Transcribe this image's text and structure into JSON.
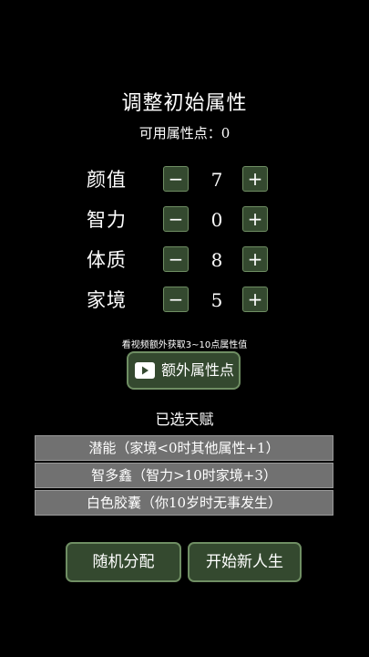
{
  "header": {
    "title": "调整初始属性",
    "points_text": "可用属性点：0"
  },
  "attributes": [
    {
      "label": "颜值",
      "value": "7",
      "minus": "−",
      "plus": "+"
    },
    {
      "label": "智力",
      "value": "0",
      "minus": "−",
      "plus": "+"
    },
    {
      "label": "体质",
      "value": "8",
      "minus": "−",
      "plus": "+"
    },
    {
      "label": "家境",
      "value": "5",
      "minus": "−",
      "plus": "+"
    }
  ],
  "extra": {
    "hint": "看视频额外获取3~10点属性值",
    "button_label": "额外属性点",
    "icon": "video-camera-icon"
  },
  "talents": {
    "title": "已选天赋",
    "items": [
      "潜能（家境<0时其他属性+1）",
      "智多鑫（智力>10时家境+3）",
      "白色胶囊（你10岁时无事发生）"
    ]
  },
  "actions": {
    "random_label": "随机分配",
    "start_label": "开始新人生"
  },
  "colors": {
    "background": "#000000",
    "button_fill": "#34492f",
    "button_border": "#6f8e63",
    "talent_fill": "#717171"
  }
}
